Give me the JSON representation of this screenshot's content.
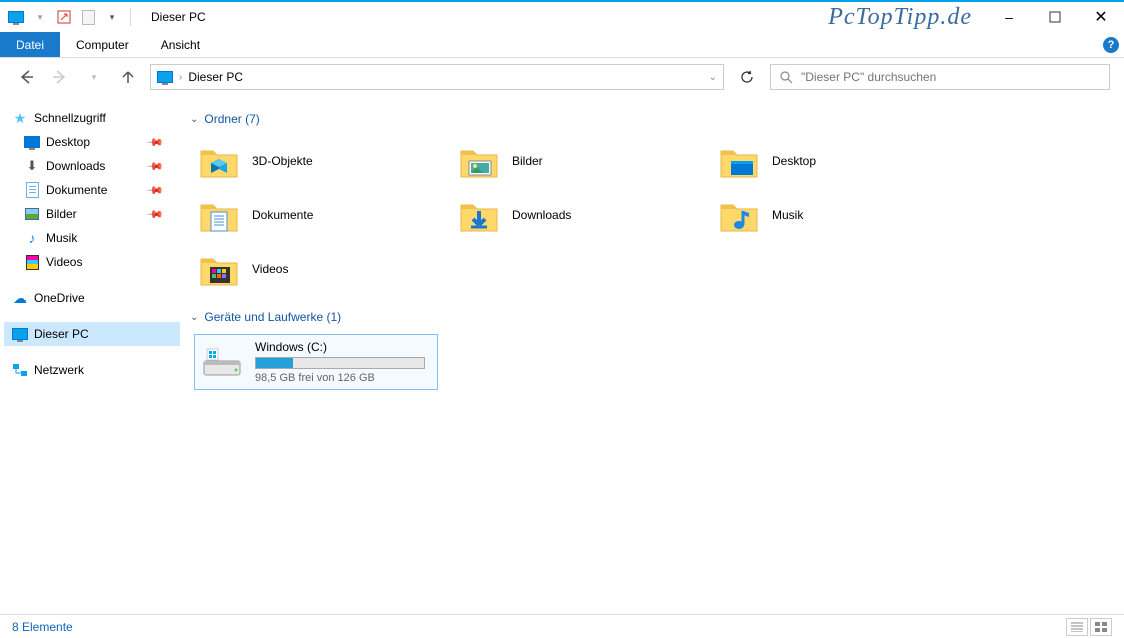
{
  "titlebar": {
    "title": "Dieser PC"
  },
  "watermark": "PcTopTipp.de",
  "ribbon": {
    "file": "Datei",
    "tabs": [
      "Computer",
      "Ansicht"
    ]
  },
  "address": {
    "location": "Dieser PC"
  },
  "search": {
    "placeholder": "\"Dieser PC\" durchsuchen"
  },
  "sidebar": {
    "quickaccess": {
      "label": "Schnellzugriff",
      "items": [
        {
          "label": "Desktop",
          "pinned": true
        },
        {
          "label": "Downloads",
          "pinned": true
        },
        {
          "label": "Dokumente",
          "pinned": true
        },
        {
          "label": "Bilder",
          "pinned": true
        },
        {
          "label": "Musik",
          "pinned": false
        },
        {
          "label": "Videos",
          "pinned": false
        }
      ]
    },
    "onedrive": "OneDrive",
    "thispc": "Dieser PC",
    "network": "Netzwerk"
  },
  "content": {
    "folders_header": "Ordner (7)",
    "folders": [
      {
        "label": "3D-Objekte",
        "icon": "3d"
      },
      {
        "label": "Bilder",
        "icon": "pictures"
      },
      {
        "label": "Desktop",
        "icon": "desktop"
      },
      {
        "label": "Dokumente",
        "icon": "documents"
      },
      {
        "label": "Downloads",
        "icon": "downloads"
      },
      {
        "label": "Musik",
        "icon": "music"
      },
      {
        "label": "Videos",
        "icon": "videos"
      }
    ],
    "drives_header": "Geräte und Laufwerke (1)",
    "drive": {
      "label": "Windows (C:)",
      "free_text": "98,5 GB frei von 126 GB",
      "fill_percent": 22
    }
  },
  "statusbar": {
    "count": "8 Elemente"
  }
}
